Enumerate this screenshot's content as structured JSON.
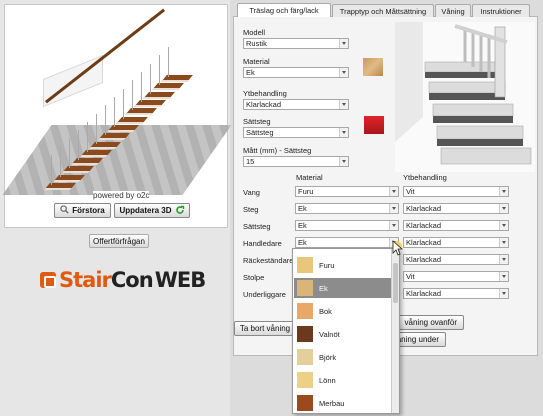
{
  "viewer": {
    "powered_by": "powered by o2c",
    "enlarge_label": "Förstora",
    "update_label": "Uppdatera 3D",
    "offer_label": "Offertförfrågan"
  },
  "logo": {
    "part1": "Stair",
    "part2": "Con",
    "part3": "WEB",
    "accent": "#e05a12"
  },
  "tabs": [
    {
      "label": "Träslag och färg/lack",
      "active": true
    },
    {
      "label": "Trapptyp och Måttsättning",
      "active": false
    },
    {
      "label": "Våning",
      "active": false
    },
    {
      "label": "Instruktioner",
      "active": false
    }
  ],
  "form": {
    "modell": {
      "label": "Modell",
      "value": "Rustik"
    },
    "material": {
      "label": "Material",
      "value": "Ek"
    },
    "ytbehandling": {
      "label": "Ytbehandling",
      "value": "Klarlackad"
    },
    "sattsteg": {
      "label": "Sättsteg",
      "value": "Sättsteg"
    },
    "matt": {
      "label": "Mått (mm) - Sättsteg",
      "value": "15"
    }
  },
  "grid": {
    "col_material": "Material",
    "col_ytbehandling": "Ytbehandling",
    "rows": [
      {
        "label": "Vang",
        "material": "Furu",
        "finish": "Vit"
      },
      {
        "label": "Steg",
        "material": "Ek",
        "finish": "Klarlackad"
      },
      {
        "label": "Sättsteg",
        "material": "Ek",
        "finish": "Klarlackad"
      },
      {
        "label": "Handledare",
        "material": "Ek",
        "finish": "Klarlackad"
      },
      {
        "label": "Räckeständare",
        "material": "",
        "finish": "Klarlackad"
      },
      {
        "label": "Stolpe",
        "material": "",
        "finish": "Vit"
      },
      {
        "label": "Underliggare",
        "material": "",
        "finish": "Klarlackad"
      }
    ]
  },
  "buttons": {
    "remove_floor": "Ta bort våning",
    "floor_above": "våning ovanför",
    "floor_below": "våning under"
  },
  "dropdown": {
    "items": [
      {
        "label": "Furu",
        "color": "#e6c77c"
      },
      {
        "label": "Ek",
        "color": "#d9b57a",
        "highlighted": true
      },
      {
        "label": "Bok",
        "color": "#e7a86a"
      },
      {
        "label": "Valnöt",
        "color": "#6b3a1e"
      },
      {
        "label": "Björk",
        "color": "#e2cf9c"
      },
      {
        "label": "Lönn",
        "color": "#ecd088"
      },
      {
        "label": "Merbau",
        "color": "#9b4a1f"
      }
    ]
  }
}
